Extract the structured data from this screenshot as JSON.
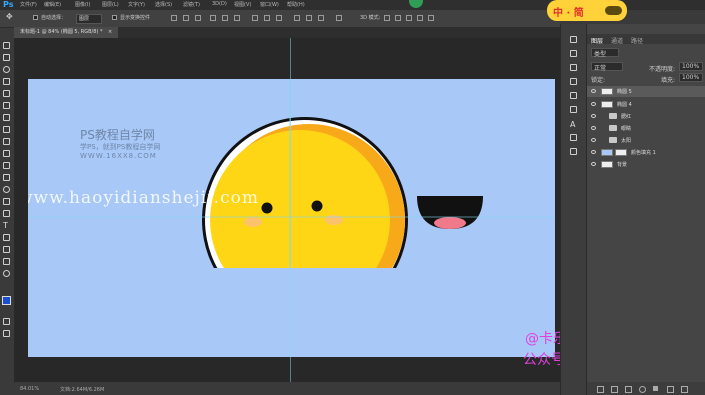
{
  "app": {
    "logo": "Ps"
  },
  "menu": [
    "文件(F)",
    "编辑(E)",
    "图像(I)",
    "图层(L)",
    "文字(Y)",
    "选择(S)",
    "滤镜(T)",
    "3D(D)",
    "视图(V)",
    "窗口(W)",
    "帮助(H)"
  ],
  "options": {
    "auto_select_label": "自动选择：",
    "auto_select_value": "图层",
    "transform_label": "显示变换控件"
  },
  "document_tab": "未标题-1 @ 84% (椭圆 5, RGB/8) *",
  "watermark": {
    "brand_title": "PS教程自学网",
    "brand_sub": "学PS，就到PS教程自学网",
    "brand_url": "WWW.16XX8.COM",
    "site_url": "www.haoyidianshejii.com",
    "author": "@卡乐筠",
    "wechat": "公众号：卡乐筠"
  },
  "badge_text": "中 · 简",
  "status": {
    "zoom": "84.01%",
    "doc_info": "文档:2.64M/6.26M"
  },
  "layers_panel": {
    "tabs": [
      "图层",
      "通道",
      "路径"
    ],
    "filter": "类型",
    "blend_mode": "正常",
    "opacity_label": "不透明度:",
    "opacity_value": "100%",
    "lock_label": "锁定:",
    "fill_label": "填充:",
    "fill_value": "100%",
    "layers": [
      {
        "name": "椭圆 5",
        "kind": "shape",
        "selected": true
      },
      {
        "name": "椭圆 4",
        "kind": "shape",
        "selected": false
      },
      {
        "name": "腮红",
        "kind": "folder",
        "selected": false
      },
      {
        "name": "眼睛",
        "kind": "folder",
        "selected": false
      },
      {
        "name": "太阳",
        "kind": "folder",
        "selected": false
      },
      {
        "name": "颜色填充 1",
        "kind": "fill",
        "selected": false
      },
      {
        "name": "背景",
        "kind": "background",
        "selected": false
      }
    ]
  },
  "colors": {
    "canvas": "#a8c8f8",
    "sun": "#ffd616",
    "sun_shade": "#f7a91a",
    "outline": "#111111",
    "blush": "#ffb3b3",
    "tongue": "#f07a8a",
    "guide": "#7fd9ee",
    "watermark_text": "#6f86a8",
    "wechat_text": "#e040e0"
  }
}
